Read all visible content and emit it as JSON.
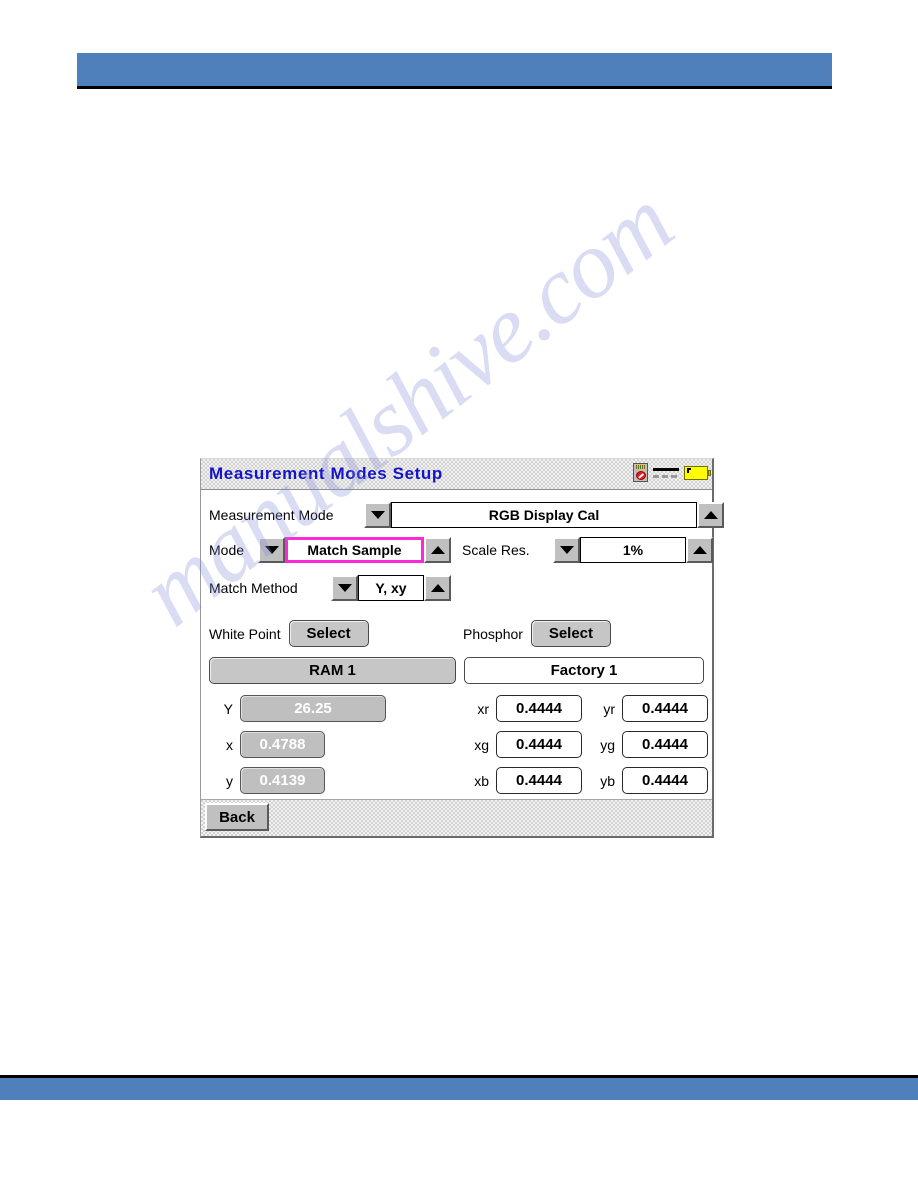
{
  "watermark": {
    "text": "manualshive.com"
  },
  "panel": {
    "title": "Measurement Modes Setup",
    "status_icons": [
      {
        "name": "memory-card-disabled-icon"
      },
      {
        "name": "signal-lines-icon"
      },
      {
        "name": "battery-icon"
      }
    ],
    "rows": {
      "measurement_mode": {
        "label": "Measurement Mode",
        "value": "RGB Display Cal",
        "decrement": "▼",
        "increment": "▲"
      },
      "mode": {
        "label": "Mode",
        "value": "Match Sample",
        "decrement": "▼",
        "increment": "▲"
      },
      "scale_res": {
        "label": "Scale Res.",
        "value": "1%",
        "decrement": "▼",
        "increment": "▲"
      },
      "match_method": {
        "label": "Match Method",
        "value": "Y, xy",
        "decrement": "▼",
        "increment": "▲"
      }
    },
    "white_point": {
      "label": "White Point",
      "select_label": "Select",
      "preset": "RAM 1"
    },
    "phosphor": {
      "label": "Phosphor",
      "select_label": "Select",
      "preset": "Factory 1"
    },
    "white_point_values": [
      {
        "label": "Y",
        "value": "26.25"
      },
      {
        "label": "x",
        "value": "0.4788"
      },
      {
        "label": "y",
        "value": "0.4139"
      }
    ],
    "phosphor_values": [
      {
        "label": "xr",
        "value": "0.4444"
      },
      {
        "label": "yr",
        "value": "0.4444"
      },
      {
        "label": "xg",
        "value": "0.4444"
      },
      {
        "label": "yg",
        "value": "0.4444"
      },
      {
        "label": "xb",
        "value": "0.4444"
      },
      {
        "label": "yb",
        "value": "0.4444"
      }
    ],
    "back_label": "Back"
  },
  "colors": {
    "page_bar": "#4f80bc",
    "title_text": "#1414c8",
    "selection_border": "#ff28d8",
    "battery": "#ffff00"
  }
}
